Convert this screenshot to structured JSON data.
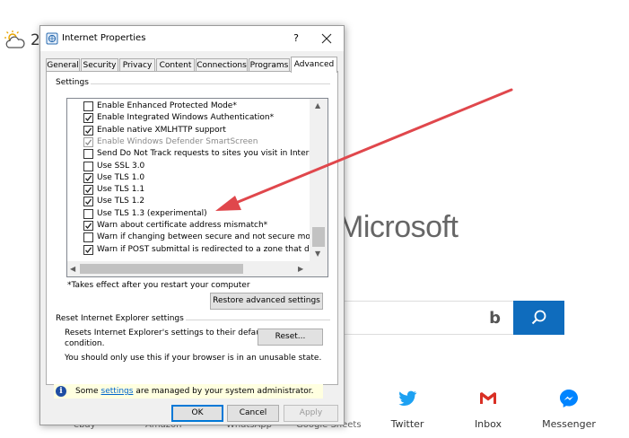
{
  "background": {
    "weather_text": "2",
    "logo_text": "Microsoft",
    "shortcuts": [
      {
        "label": "Twitter",
        "icon": "twitter-icon",
        "color": "#1da1f2"
      },
      {
        "label": "Inbox",
        "icon": "gmail-icon",
        "color": "#d93025"
      },
      {
        "label": "Messenger",
        "icon": "messenger-icon",
        "color": "#0084ff"
      }
    ],
    "search_button_color": "#0f6cbd",
    "cut_labels": [
      "ebay",
      "Amazon",
      "WhatsApp",
      "Google Sheets"
    ]
  },
  "dialog": {
    "title": "Internet Properties",
    "help_label": "?",
    "tabs": [
      "General",
      "Security",
      "Privacy",
      "Content",
      "Connections",
      "Programs",
      "Advanced"
    ],
    "active_tab": "Advanced",
    "settings_label": "Settings",
    "settings_items": [
      {
        "label": "Enable Enhanced Protected Mode*",
        "checked": false,
        "disabled": false
      },
      {
        "label": "Enable Integrated Windows Authentication*",
        "checked": true,
        "disabled": false
      },
      {
        "label": "Enable native XMLHTTP support",
        "checked": true,
        "disabled": false
      },
      {
        "label": "Enable Windows Defender SmartScreen",
        "checked": true,
        "disabled": true
      },
      {
        "label": "Send Do Not Track requests to sites you visit in Internet E",
        "checked": false,
        "disabled": false
      },
      {
        "label": "Use SSL 3.0",
        "checked": false,
        "disabled": false
      },
      {
        "label": "Use TLS 1.0",
        "checked": true,
        "disabled": false
      },
      {
        "label": "Use TLS 1.1",
        "checked": true,
        "disabled": false
      },
      {
        "label": "Use TLS 1.2",
        "checked": true,
        "disabled": false
      },
      {
        "label": "Use TLS 1.3 (experimental)",
        "checked": false,
        "disabled": false
      },
      {
        "label": "Warn about certificate address mismatch*",
        "checked": true,
        "disabled": false
      },
      {
        "label": "Warn if changing between secure and not secure mode",
        "checked": false,
        "disabled": false
      },
      {
        "label": "Warn if POST submittal is redirected to a zone that does n",
        "checked": true,
        "disabled": false
      }
    ],
    "restart_note": "*Takes effect after you restart your computer",
    "restore_button": "Restore advanced settings",
    "reset_group_label": "Reset Internet Explorer settings",
    "reset_description_line1": "Resets Internet Explorer's settings to their default",
    "reset_description_line2": "condition.",
    "reset_button": "Reset...",
    "unusable_note": "You should only use this if your browser is in an unusable state.",
    "info_prefix": "Some",
    "info_link": "settings",
    "info_suffix": "are managed by your system administrator.",
    "ok_button": "OK",
    "cancel_button": "Cancel",
    "apply_button": "Apply"
  },
  "colors": {
    "annotation_arrow": "#e0474c",
    "accent_blue": "#0078d7"
  }
}
